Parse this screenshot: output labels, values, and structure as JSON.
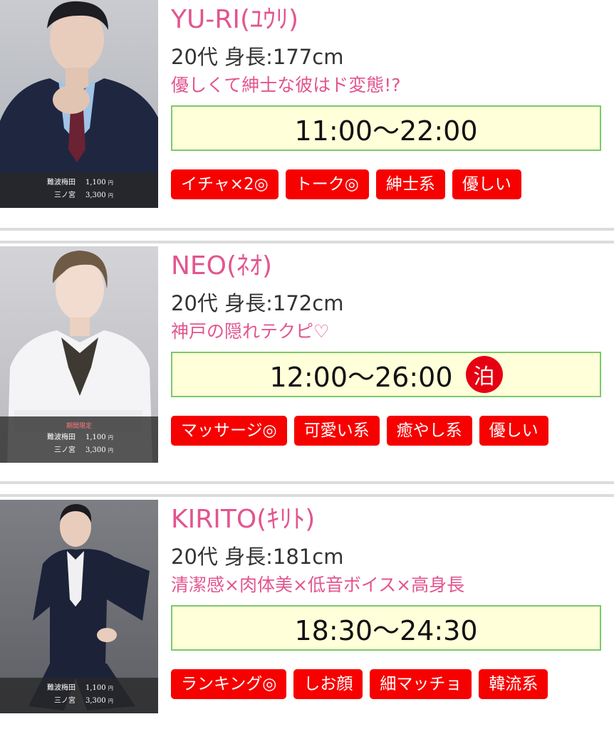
{
  "cast": [
    {
      "name": "YU-RI(ﾕｳﾘ)",
      "age": "20代",
      "height": "身長:177cm",
      "catchphrase": "優しくて紳士な彼はド変態!?",
      "hours": "11:00〜22:00",
      "overnight": "",
      "photo_label": "",
      "prices": [
        {
          "location": "難波梅田",
          "amount": "1,100",
          "unit": "円"
        },
        {
          "location": "三ノ宮",
          "amount": "3,300",
          "unit": "円"
        }
      ],
      "tags": [
        "イチャ×2◎",
        "トーク◎",
        "紳士系",
        "優しい"
      ]
    },
    {
      "name": "NEO(ﾈｵ)",
      "age": "20代",
      "height": "身長:172cm",
      "catchphrase": "神戸の隠れテクピ♡",
      "hours": "12:00〜26:00",
      "overnight": "泊",
      "photo_label": "期間限定",
      "prices": [
        {
          "location": "難波梅田",
          "amount": "1,100",
          "unit": "円"
        },
        {
          "location": "三ノ宮",
          "amount": "3,300",
          "unit": "円"
        }
      ],
      "tags": [
        "マッサージ◎",
        "可愛い系",
        "癒やし系",
        "優しい"
      ]
    },
    {
      "name": "KIRITO(ｷﾘﾄ)",
      "age": "20代",
      "height": "身長:181cm",
      "catchphrase": "清潔感×肉体美×低音ボイス×高身長",
      "hours": "18:30〜24:30",
      "overnight": "",
      "photo_label": "",
      "prices": [
        {
          "location": "難波梅田",
          "amount": "1,100",
          "unit": "円"
        },
        {
          "location": "三ノ宮",
          "amount": "3,300",
          "unit": "円"
        }
      ],
      "tags": [
        "ランキング◎",
        "しお顔",
        "細マッチョ",
        "韓流系"
      ]
    }
  ],
  "colors": {
    "name_pink": "#e2558f",
    "tag_red": "#f60000",
    "hours_bg": "#ffffd9",
    "hours_border": "#7cc96b",
    "overnight_red": "#e60012"
  }
}
